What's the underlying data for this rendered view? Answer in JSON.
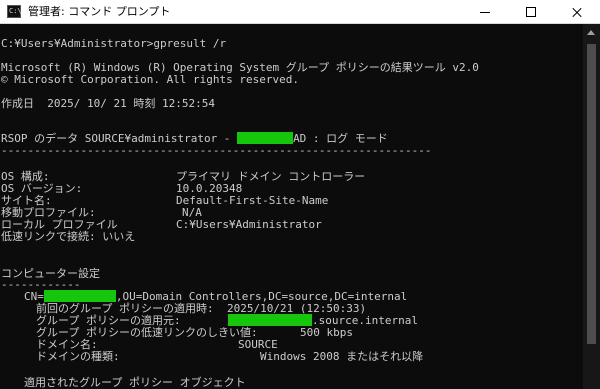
{
  "window": {
    "title": "管理者: コマンド プロンプト",
    "icon_text": "C:\\",
    "icons": {
      "app": "command-prompt-icon",
      "minimize": "minimize-icon",
      "maximize": "maximize-icon",
      "close": "close-icon"
    }
  },
  "console": {
    "prompt": "C:¥Users¥Administrator>gpresult /r",
    "banner_line1": "Microsoft (R) Windows (R) Operating System グループ ポリシーの結果ツール v2.0",
    "banner_line2": "© Microsoft Corporation. All rights reserved.",
    "created": "作成日  2025/ 10/ 21 時刻 12:52:54",
    "rsop_prefix": "RSOP のデータ SOURCE¥administrator - ",
    "rsop_suffix": "AD : ログ モード",
    "separator": "-----------------------------------------------------------------",
    "os_config_label": "OS 構成:",
    "os_config_value": "プライマリ ドメイン コントローラー",
    "os_version_label": "OS バージョン:",
    "os_version_value": "10.0.20348",
    "site_label": "サイト名:",
    "site_value": "Default-First-Site-Name",
    "roaming_label": "移動プロファイル:",
    "roaming_value": "N/A",
    "local_profile_label": "ローカル プロファイル",
    "local_profile_value": "C:¥Users¥Administrator",
    "slow_link": "低速リンクで接続: いいえ",
    "computer_settings_title": "コンピューター設定",
    "computer_settings_underline": "------------",
    "cn_prefix": "CN=",
    "cn_suffix": ",OU=Domain Controllers,DC=source,DC=internal",
    "last_applied_label": "前回のグループ ポリシーの適用時:",
    "last_applied_value": "2025/10/21 (12:50:33)",
    "applied_from_label": "グループ ポリシーの適用元:",
    "applied_from_suffix": ".source.internal",
    "slow_threshold_label": "グループ ポリシーの低速リンクのしきい値:",
    "slow_threshold_value": "500 kbps",
    "domain_name_label": "ドメイン名:",
    "domain_name_value": "SOURCE",
    "domain_type_label": "ドメインの種類:",
    "domain_type_value": "Windows 2008 またはそれ以降",
    "applied_gpo_title": "適用されたグループ ポリシー オブジェクト",
    "redaction_color": "#16c60c"
  }
}
